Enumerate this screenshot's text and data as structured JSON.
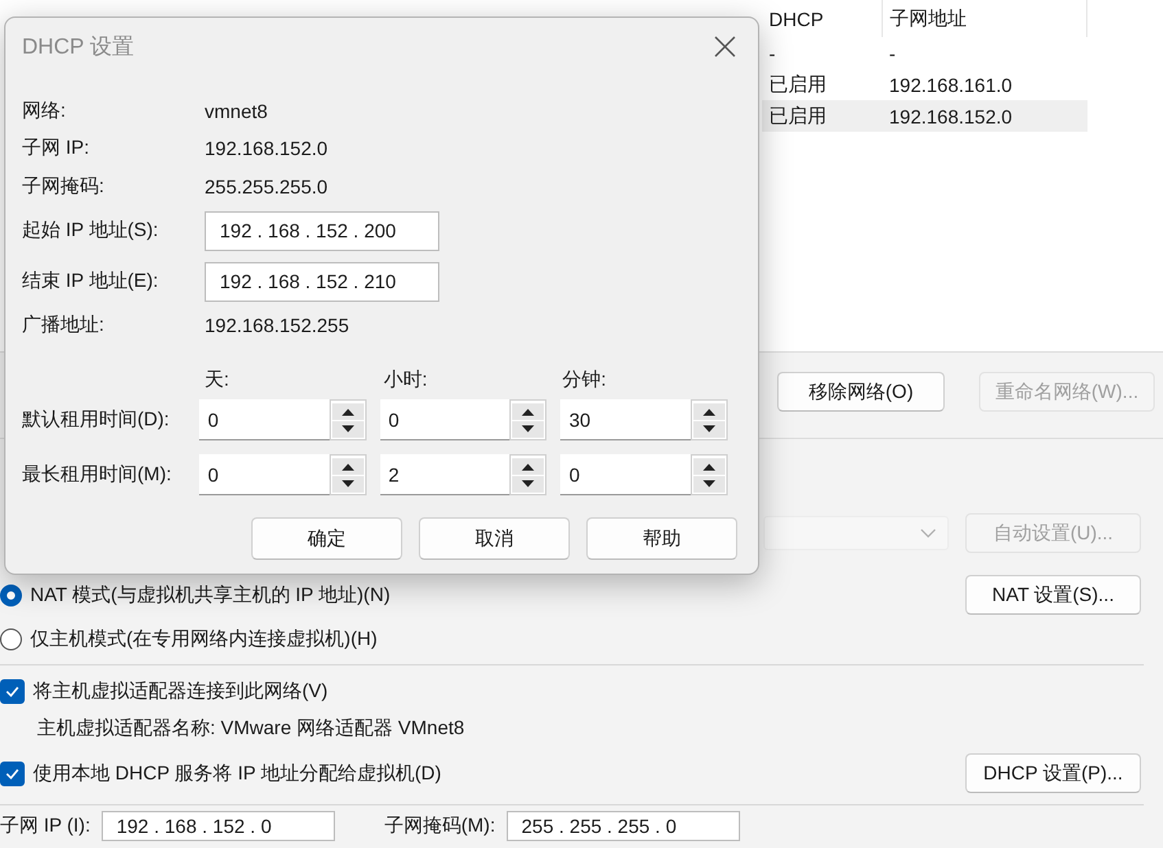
{
  "network_table": {
    "columns": [
      "DHCP",
      "子网地址"
    ],
    "rows": [
      {
        "cells": [
          "-",
          "-"
        ],
        "selected": false
      },
      {
        "cells": [
          "已启用",
          "192.168.161.0"
        ],
        "selected": false
      },
      {
        "cells": [
          "已启用",
          "192.168.152.0"
        ],
        "selected": true
      }
    ]
  },
  "network_buttons": [
    {
      "label": "移除网络(O)",
      "disabled": false
    },
    {
      "label": "重命名网络(W)...",
      "disabled": true
    }
  ],
  "nat_section": {
    "dropdown": {
      "disabled": true
    },
    "auto_button": {
      "label": "自动设置(U)...",
      "disabled": true
    },
    "nat_button": {
      "label": "NAT 设置(S)...",
      "disabled": false
    },
    "modes": [
      {
        "label": "NAT 模式(与虚拟机共享主机的 IP 地址)(N)",
        "selected": true
      },
      {
        "label": "仅主机模式(在专用网络内连接虚拟机)(H)",
        "selected": false
      }
    ]
  },
  "adapter": {
    "connect": {
      "label": "将主机虚拟适配器连接到此网络(V)",
      "checked": true
    },
    "adapter_name": "主机虚拟适配器名称: VMware 网络适配器 VMnet8",
    "dhcp": {
      "label": "使用本地 DHCP 服务将 IP 地址分配给虚拟机(D)",
      "checked": true
    },
    "dhcp_button": {
      "label": "DHCP 设置(P)...",
      "disabled": false
    }
  },
  "subnet": {
    "ip_label": "子网 IP (I):",
    "ip_value": "192 . 168 . 152 . 0",
    "mask_label": "子网掩码(M):",
    "mask_value": "255 . 255 . 255 . 0"
  },
  "dhcp_dialog": {
    "title": "DHCP 设置",
    "fields": [
      {
        "kind": "text",
        "label": "网络:",
        "value": "vmnet8"
      },
      {
        "kind": "text",
        "label": "子网 IP:",
        "value": "192.168.152.0"
      },
      {
        "kind": "text",
        "label": "子网掩码:",
        "value": "255.255.255.0"
      },
      {
        "kind": "ip",
        "label": "起始 IP 地址(S):",
        "value": "192 . 168 . 152 . 200"
      },
      {
        "kind": "ip",
        "label": "结束 IP 地址(E):",
        "value": "192 . 168 . 152 . 210"
      },
      {
        "kind": "text",
        "label": "广播地址:",
        "value": "192.168.152.255"
      }
    ],
    "lease_columns": [
      "天:",
      "小时:",
      "分钟:"
    ],
    "leases": [
      {
        "label": "默认租用时间(D):",
        "values": [
          "0",
          "0",
          "30"
        ]
      },
      {
        "label": "最长租用时间(M):",
        "values": [
          "0",
          "2",
          "0"
        ]
      }
    ],
    "buttons": [
      "确定",
      "取消",
      "帮助"
    ]
  }
}
